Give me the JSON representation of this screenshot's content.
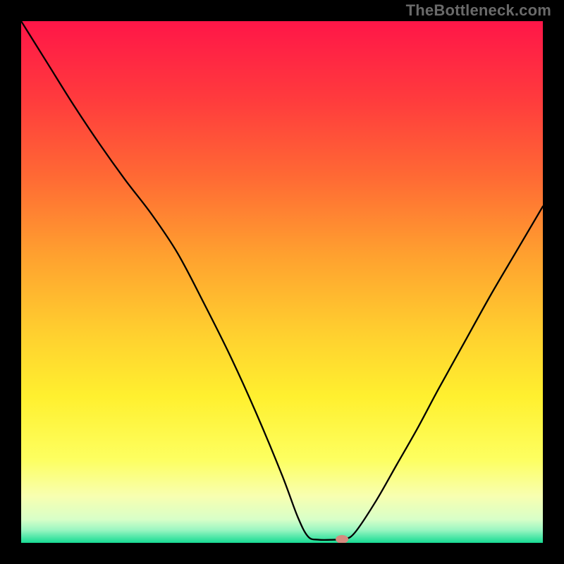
{
  "watermark": "TheBottleneck.com",
  "chart_data": {
    "type": "line",
    "title": "",
    "xlabel": "",
    "ylabel": "",
    "xlim": [
      0,
      100
    ],
    "ylim": [
      0,
      100
    ],
    "grid": false,
    "background": {
      "type": "vertical-gradient",
      "stops": [
        {
          "pos": 0.0,
          "color": "#ff1648"
        },
        {
          "pos": 0.15,
          "color": "#ff3b3d"
        },
        {
          "pos": 0.3,
          "color": "#ff6a34"
        },
        {
          "pos": 0.45,
          "color": "#ffa12f"
        },
        {
          "pos": 0.6,
          "color": "#ffd02f"
        },
        {
          "pos": 0.72,
          "color": "#fff02f"
        },
        {
          "pos": 0.84,
          "color": "#fdff60"
        },
        {
          "pos": 0.91,
          "color": "#f8ffb0"
        },
        {
          "pos": 0.955,
          "color": "#d8ffc8"
        },
        {
          "pos": 0.975,
          "color": "#9cf6c2"
        },
        {
          "pos": 0.99,
          "color": "#4ae6a6"
        },
        {
          "pos": 1.0,
          "color": "#18db93"
        }
      ]
    },
    "series": [
      {
        "name": "bottleneck-curve",
        "color": "#000000",
        "width": 2.3,
        "points": [
          {
            "x": 0.0,
            "y": 100.0
          },
          {
            "x": 5.0,
            "y": 92.0
          },
          {
            "x": 10.0,
            "y": 84.0
          },
          {
            "x": 15.0,
            "y": 76.5
          },
          {
            "x": 20.0,
            "y": 69.5
          },
          {
            "x": 25.0,
            "y": 63.0
          },
          {
            "x": 30.0,
            "y": 55.5
          },
          {
            "x": 35.0,
            "y": 46.0
          },
          {
            "x": 40.0,
            "y": 36.0
          },
          {
            "x": 45.0,
            "y": 25.0
          },
          {
            "x": 50.0,
            "y": 13.0
          },
          {
            "x": 53.0,
            "y": 5.0
          },
          {
            "x": 55.0,
            "y": 1.2
          },
          {
            "x": 57.0,
            "y": 0.6
          },
          {
            "x": 60.0,
            "y": 0.6
          },
          {
            "x": 62.0,
            "y": 0.7
          },
          {
            "x": 64.0,
            "y": 2.0
          },
          {
            "x": 68.0,
            "y": 8.0
          },
          {
            "x": 72.0,
            "y": 15.0
          },
          {
            "x": 76.0,
            "y": 22.0
          },
          {
            "x": 80.0,
            "y": 29.5
          },
          {
            "x": 85.0,
            "y": 38.5
          },
          {
            "x": 90.0,
            "y": 47.5
          },
          {
            "x": 95.0,
            "y": 56.0
          },
          {
            "x": 100.0,
            "y": 64.5
          }
        ]
      }
    ],
    "marker": {
      "name": "optimal-point",
      "x": 61.5,
      "y": 0.7,
      "color": "#d58b7f",
      "rx": 9,
      "ry": 6
    }
  }
}
